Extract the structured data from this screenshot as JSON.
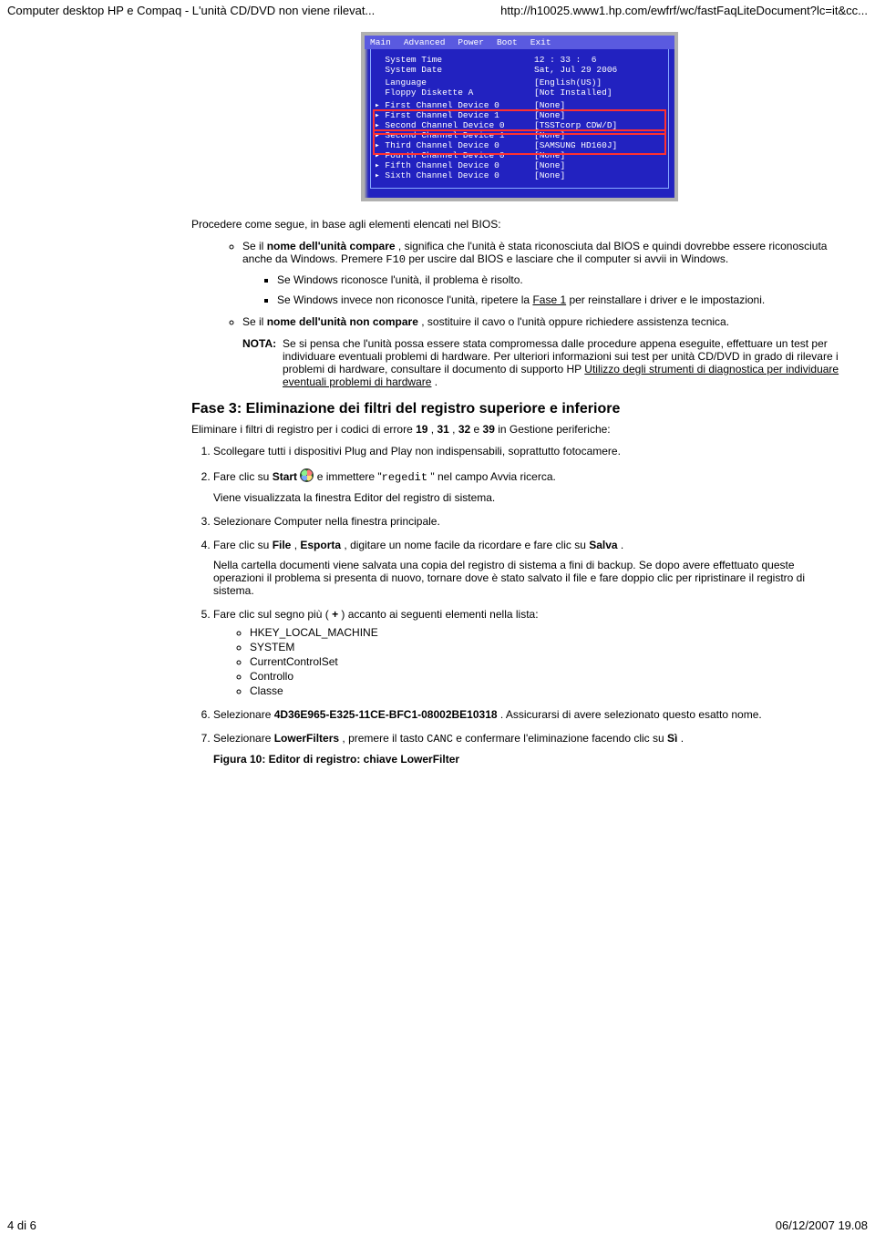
{
  "header": {
    "left": "Computer desktop HP e Compaq -  L'unità CD/DVD non viene rilevat...",
    "right": "http://h10025.www1.hp.com/ewfrf/wc/fastFaqLiteDocument?lc=it&cc..."
  },
  "bios": {
    "menu": [
      "Main",
      "Advanced",
      "Power",
      "Boot",
      "Exit"
    ],
    "rows": [
      {
        "label": "System Time",
        "value": "12 : 33 :  6",
        "caret": false
      },
      {
        "label": "System Date",
        "value": "Sat, Jul 29 2006",
        "caret": false
      },
      {
        "blank": true
      },
      {
        "label": "Language",
        "value": "[English(US)]",
        "caret": false
      },
      {
        "label": "Floppy Diskette A",
        "value": "[Not Installed]",
        "caret": false
      },
      {
        "blank": true
      },
      {
        "label": "First Channel Device 0",
        "value": "[None]",
        "caret": true
      },
      {
        "label": "First Channel Device 1",
        "value": "[None]",
        "caret": true,
        "red1": true
      },
      {
        "label": "Second Channel Device 0",
        "value": "[TSSTcorp CDW/D]",
        "caret": true,
        "red1": true
      },
      {
        "label": "Second Channel Device 1",
        "value": "[None]",
        "caret": true,
        "red2": true
      },
      {
        "label": "Third Channel Device 0",
        "value": "[SAMSUNG HD160J]",
        "caret": true,
        "red2": true
      },
      {
        "label": "Fourth Channel Device 0",
        "value": "[None]",
        "caret": true
      },
      {
        "label": "Fifth Channel Device 0",
        "value": "[None]",
        "caret": true
      },
      {
        "label": "Sixth Channel Device 0",
        "value": "[None]",
        "caret": true
      }
    ]
  },
  "body": {
    "p_intro": "Procedere come segue, in base agli elementi elencati nel BIOS:",
    "b1_pre": "Se il ",
    "b1_bold": "nome dell'unità compare",
    "b1_post_a": " , significa che l'unità è stata riconosciuta dal BIOS e quindi dovrebbe essere riconosciuta anche da Windows. Premere ",
    "b1_code": "F10",
    "b1_post_b": " per uscire dal BIOS e lasciare che il computer si avvii in Windows.",
    "sub1": "Se Windows riconosce l'unità, il problema è risolto.",
    "sub2_a": "Se Windows invece non riconosce l'unità, ripetere la ",
    "sub2_link": "Fase 1",
    "sub2_b": " per reinstallare i driver e le impostazioni.",
    "b2_pre": "Se il ",
    "b2_bold": "nome dell'unità non compare",
    "b2_post": " , sostituire il cavo o l'unità oppure richiedere assistenza tecnica.",
    "nota_label": "NOTA:",
    "nota_a": "Se si pensa che l'unità possa essere stata compromessa dalle procedure appena eseguite, effettuare un test per individuare eventuali problemi di hardware. Per ulteriori informazioni sui test per unità CD/DVD in grado di rilevare i problemi di hardware, consultare il documento di supporto HP ",
    "nota_link": "Utilizzo degli strumenti di diagnostica per individuare eventuali problemi di hardware",
    "nota_b": " ."
  },
  "fase3": {
    "title": "Fase 3: Eliminazione dei filtri del registro superiore e inferiore",
    "sub_a": "Eliminare i filtri di registro per i codici di errore ",
    "c19": "19",
    "c31": "31",
    "c32": "32",
    "c39": "39",
    "sub_b": " in Gestione periferiche:",
    "s1": "Scollegare tutti i dispositivi Plug and Play non indispensabili, soprattutto fotocamere.",
    "s2_a": "Fare clic su ",
    "s2_start": "Start",
    "s2_b": " ",
    "s2_c": " e immettere \"",
    "s2_code": "regedit",
    "s2_d": " \" nel campo Avvia ricerca.",
    "s2_sub": "Viene visualizzata la finestra Editor del registro di sistema.",
    "s3": "Selezionare Computer nella finestra principale.",
    "s4_a": "Fare clic su ",
    "s4_file": "File",
    "s4_b": " , ",
    "s4_esp": "Esporta",
    "s4_c": " , digitare un nome facile da ricordare e fare clic su ",
    "s4_salva": "Salva",
    "s4_d": " .",
    "s4_sub": "Nella cartella documenti viene salvata una copia del registro di sistema a fini di backup. Se dopo avere effettuato queste operazioni il problema si presenta di nuovo, tornare dove è stato salvato il file e fare doppio clic per ripristinare il registro di sistema.",
    "s5_a": "Fare clic sul segno più ( ",
    "s5_plus": "+",
    "s5_b": " ) accanto ai seguenti elementi nella lista:",
    "s5_items": [
      "HKEY_LOCAL_MACHINE",
      "SYSTEM",
      "CurrentControlSet",
      "Controllo",
      "Classe"
    ],
    "s6_a": "Selezionare ",
    "s6_guid": "4D36E965-E325-11CE-BFC1-08002BE10318",
    "s6_b": " . Assicurarsi di avere selezionato questo esatto nome.",
    "s7_a": "Selezionare ",
    "s7_lf": "LowerFilters",
    "s7_b": " , premere il tasto ",
    "s7_code": "CANC",
    "s7_c": " e confermare l'eliminazione facendo clic su ",
    "s7_si": "Sì",
    "s7_d": " .",
    "fig10": "Figura 10: Editor di registro: chiave LowerFilter"
  },
  "footer": {
    "left": "4 di 6",
    "right": "06/12/2007 19.08"
  }
}
